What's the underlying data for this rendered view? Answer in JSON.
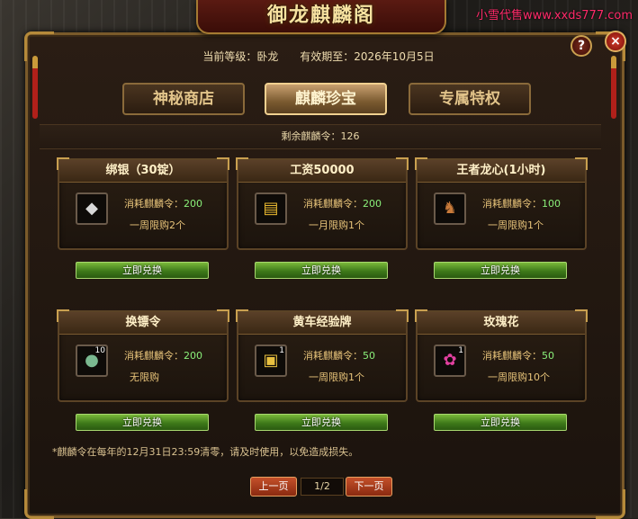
{
  "watermark": "小雪代售www.xxds777.com",
  "window": {
    "title": "御龙麒麟阁",
    "help_icon": "?",
    "close_icon": "×"
  },
  "info": {
    "level_label": "当前等级：卧龙",
    "expiry_label": "有效期至：2026年10月5日"
  },
  "tabs": [
    {
      "label": "神秘商店",
      "active": false
    },
    {
      "label": "麒麟珍宝",
      "active": true
    },
    {
      "label": "专属特权",
      "active": false
    }
  ],
  "remaining": "剩余麒麟令：126",
  "cards": [
    {
      "title": "绑银（30锭）",
      "icon": "silver-ingot-icon",
      "glyph": "◆",
      "count": "",
      "cost_prefix": "消耗麒麟令：",
      "cost": "200",
      "limit": "一周限购2个",
      "button": "立即兑换"
    },
    {
      "title": "工资50000",
      "icon": "gold-coin-stack-icon",
      "glyph": "▤",
      "count": "",
      "cost_prefix": "消耗麒麟令：",
      "cost": "200",
      "limit": "一月限购1个",
      "button": "立即兑换"
    },
    {
      "title": "王者龙心(1小时)",
      "icon": "dragon-head-icon",
      "glyph": "♞",
      "count": "",
      "cost_prefix": "消耗麒麟令：",
      "cost": "100",
      "limit": "一周限购1个",
      "button": "立即兑换"
    },
    {
      "title": "换镖令",
      "icon": "token-medal-icon",
      "glyph": "●",
      "count": "10",
      "cost_prefix": "消耗麒麟令：",
      "cost": "200",
      "limit": "无限购",
      "button": "立即兑换"
    },
    {
      "title": "黄车经验牌",
      "icon": "yellow-cart-icon",
      "glyph": "▣",
      "count": "1",
      "cost_prefix": "消耗麒麟令：",
      "cost": "50",
      "limit": "一周限购1个",
      "button": "立即兑换"
    },
    {
      "title": "玫瑰花",
      "icon": "rose-icon",
      "glyph": "✿",
      "count": "1",
      "cost_prefix": "消耗麒麟令：",
      "cost": "50",
      "limit": "一周限购10个",
      "button": "立即兑换"
    }
  ],
  "notice": "*麒麟令在每年的12月31日23:59清零，请及时使用，以免造成损失。",
  "pager": {
    "prev": "上一页",
    "page": "1/2",
    "next": "下一页"
  },
  "colors": {
    "accent_gold": "#e8c47a",
    "cost_green": "#8af07a",
    "button_green": "#4a8a20",
    "pager_red": "#a83818"
  }
}
